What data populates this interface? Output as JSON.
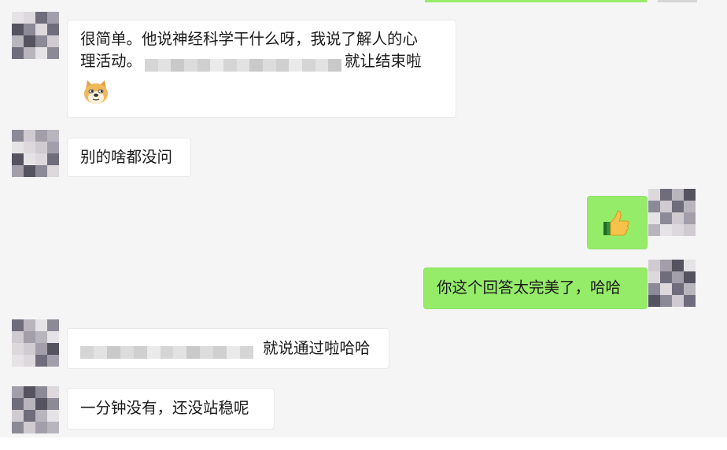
{
  "colors": {
    "background": "#f5f5f5",
    "incoming_bubble": "#ffffff",
    "outgoing_bubble": "#95ec69"
  },
  "messages": [
    {
      "side": "in",
      "line1": "很简单。他说神经科学干什么呀，我说了解人的心",
      "line2_start": "理活动。",
      "line2_end": "就让结束啦",
      "emoji": "doge-emoji"
    },
    {
      "side": "in",
      "text": "别的啥都没问"
    },
    {
      "side": "out",
      "emoji": "thumbs-up-emoji"
    },
    {
      "side": "out",
      "text": "你这个回答太完美了，哈哈"
    },
    {
      "side": "in",
      "text_end": "就说通过啦哈哈"
    },
    {
      "side": "in",
      "text": "一分钟没有，还没站稳呢"
    }
  ]
}
